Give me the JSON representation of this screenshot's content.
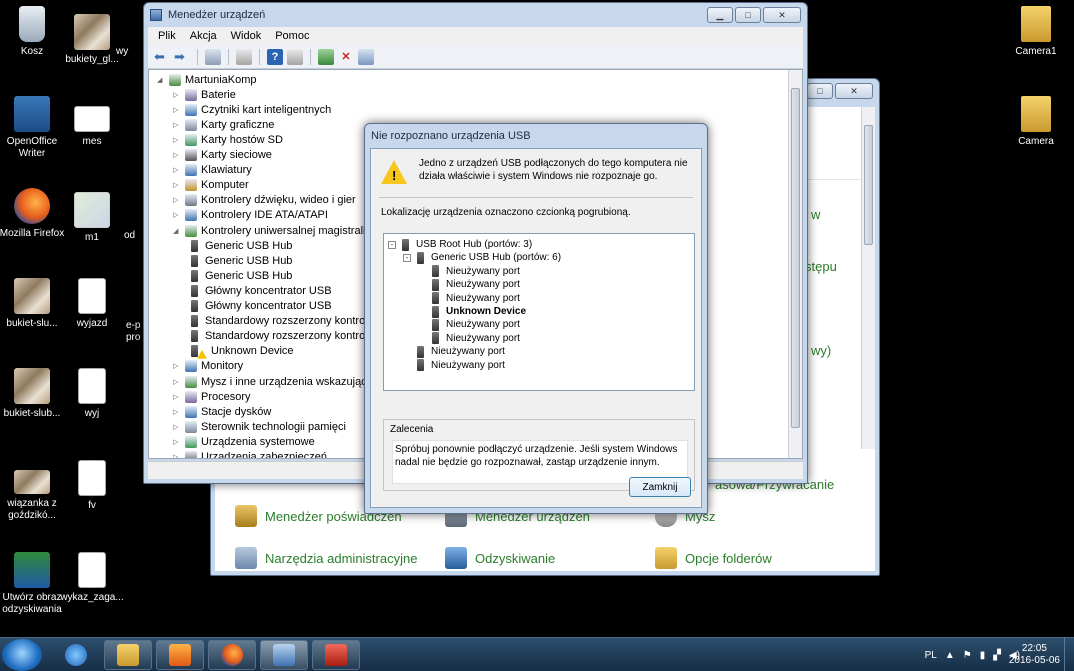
{
  "desktop": {
    "icons": [
      {
        "label": "Kosz"
      },
      {
        "label": "bukiety_gl..."
      },
      {
        "label": "wy"
      },
      {
        "label": "OpenOffice Writer"
      },
      {
        "label": "mes"
      },
      {
        "label": "Mozilla Firefox"
      },
      {
        "label": "m1"
      },
      {
        "label": "od"
      },
      {
        "label": "bukiet-slu..."
      },
      {
        "label": "wyjazd"
      },
      {
        "label": "e-p pro"
      },
      {
        "label": "bukiet-slub..."
      },
      {
        "label": "wyj"
      },
      {
        "label": "wiązanka z goździkó..."
      },
      {
        "label": "fv"
      },
      {
        "label": "Utwórz obraz odzyskiwania"
      },
      {
        "label": "wykaz_zaga..."
      },
      {
        "label": "Camera1"
      },
      {
        "label": "Camera"
      }
    ]
  },
  "control_panel": {
    "fragments": [
      "w",
      "stępu",
      "wy)",
      "asowa/Przywracanie"
    ],
    "items": [
      {
        "label": "Menedżer poświadczeń"
      },
      {
        "label": "Menedżer urządzeń"
      },
      {
        "label": "Mysz"
      },
      {
        "label": "Narzędzia administracyjne"
      },
      {
        "label": "Odzyskiwanie"
      },
      {
        "label": "Opcje folderów"
      }
    ]
  },
  "device_manager": {
    "title": "Menedżer urządzeń",
    "menu": [
      "Plik",
      "Akcja",
      "Widok",
      "Pomoc"
    ],
    "tree": [
      {
        "label": "MartuniaKomp",
        "level": 0,
        "expanded": true
      },
      {
        "label": "Baterie",
        "level": 1
      },
      {
        "label": "Czytniki kart inteligentnych",
        "level": 1
      },
      {
        "label": "Karty graficzne",
        "level": 1
      },
      {
        "label": "Karty hostów SD",
        "level": 1
      },
      {
        "label": "Karty sieciowe",
        "level": 1
      },
      {
        "label": "Klawiatury",
        "level": 1
      },
      {
        "label": "Komputer",
        "level": 1
      },
      {
        "label": "Kontrolery dźwięku, wideo i gier",
        "level": 1
      },
      {
        "label": "Kontrolery IDE ATA/ATAPI",
        "level": 1
      },
      {
        "label": "Kontrolery uniwersalnej magistrali sz",
        "level": 1,
        "expanded": true
      },
      {
        "label": "Generic USB Hub",
        "level": 2
      },
      {
        "label": "Generic USB Hub",
        "level": 2
      },
      {
        "label": "Generic USB Hub",
        "level": 2
      },
      {
        "label": "Główny koncentrator USB",
        "level": 2
      },
      {
        "label": "Główny koncentrator USB",
        "level": 2
      },
      {
        "label": "Standardowy rozszerzony kontrol",
        "level": 2
      },
      {
        "label": "Standardowy rozszerzony kontrol",
        "level": 2
      },
      {
        "label": "Unknown Device",
        "level": 2,
        "warning": true
      },
      {
        "label": "Monitory",
        "level": 1
      },
      {
        "label": "Mysz i inne urządzenia wskazujące",
        "level": 1
      },
      {
        "label": "Procesory",
        "level": 1
      },
      {
        "label": "Stacje dysków",
        "level": 1
      },
      {
        "label": "Sterownik technologii pamięci",
        "level": 1
      },
      {
        "label": "Urządzenia systemowe",
        "level": 1
      },
      {
        "label": "Urządzenia zabezpieczeń",
        "level": 1
      }
    ]
  },
  "usb_dialog": {
    "title": "Nie rozpoznano urządzenia USB",
    "message": "Jedno z urządzeń USB podłączonych do tego komputera nie działa właściwie i system Windows nie rozpoznaje go.",
    "info": "Lokalizację urządzenia oznaczono czcionką pogrubioną.",
    "tree": [
      {
        "label": "USB Root Hub (portów: 3)",
        "level": 0
      },
      {
        "label": "Generic USB Hub (portów: 6)",
        "level": 1
      },
      {
        "label": "Nieużywany port",
        "level": 2
      },
      {
        "label": "Nieużywany port",
        "level": 2
      },
      {
        "label": "Nieużywany port",
        "level": 2
      },
      {
        "label": "Unknown Device",
        "level": 2,
        "bold": true
      },
      {
        "label": "Nieużywany port",
        "level": 2
      },
      {
        "label": "Nieużywany port",
        "level": 2
      },
      {
        "label": "Nieużywany port",
        "level": 1
      },
      {
        "label": "Nieużywany port",
        "level": 1
      }
    ],
    "recommendation_header": "Zalecenia",
    "recommendation": "Spróbuj ponownie podłączyć urządzenie. Jeśli system Windows nadal nie będzie go rozpoznawał, zastąp urządzenie innym.",
    "close_button": "Zamknij"
  },
  "taskbar": {
    "language": "PL",
    "time": "22:05",
    "date": "2016-05-06"
  }
}
